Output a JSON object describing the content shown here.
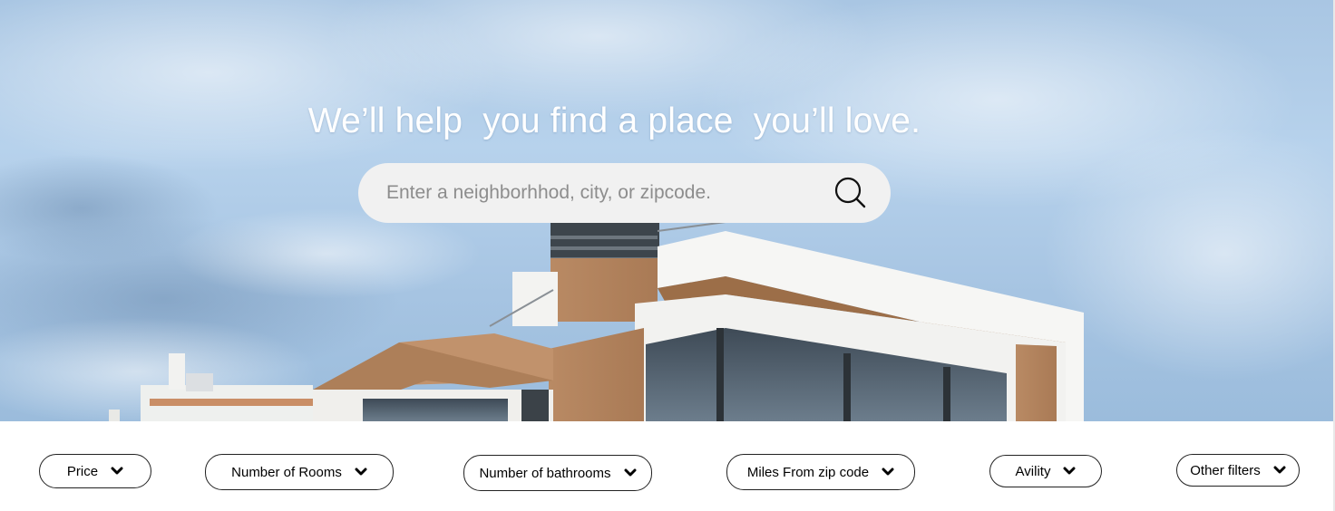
{
  "hero": {
    "title": "We’ll help  you find a place  you’ll love."
  },
  "search": {
    "placeholder": "Enter a neighborhhod, city, or zipcode.",
    "icon": "search-icon"
  },
  "filters": [
    {
      "id": "price",
      "label": "Price",
      "icon": "chevron-down-icon"
    },
    {
      "id": "rooms",
      "label": "Number of Rooms",
      "icon": "chevron-down-icon"
    },
    {
      "id": "bathrooms",
      "label": "Number of bathrooms",
      "icon": "chevron-down-icon"
    },
    {
      "id": "miles",
      "label": "Miles From zip code",
      "icon": "chevron-down-icon"
    },
    {
      "id": "avility",
      "label": "Avility",
      "icon": "chevron-down-icon"
    },
    {
      "id": "other",
      "label": "Other filters",
      "icon": "chevron-down-icon"
    }
  ],
  "colors": {
    "sky": "#a9c6e3",
    "search_bg": "#f1f1f1",
    "filter_border": "#222222",
    "title_text": "#ffffff"
  }
}
